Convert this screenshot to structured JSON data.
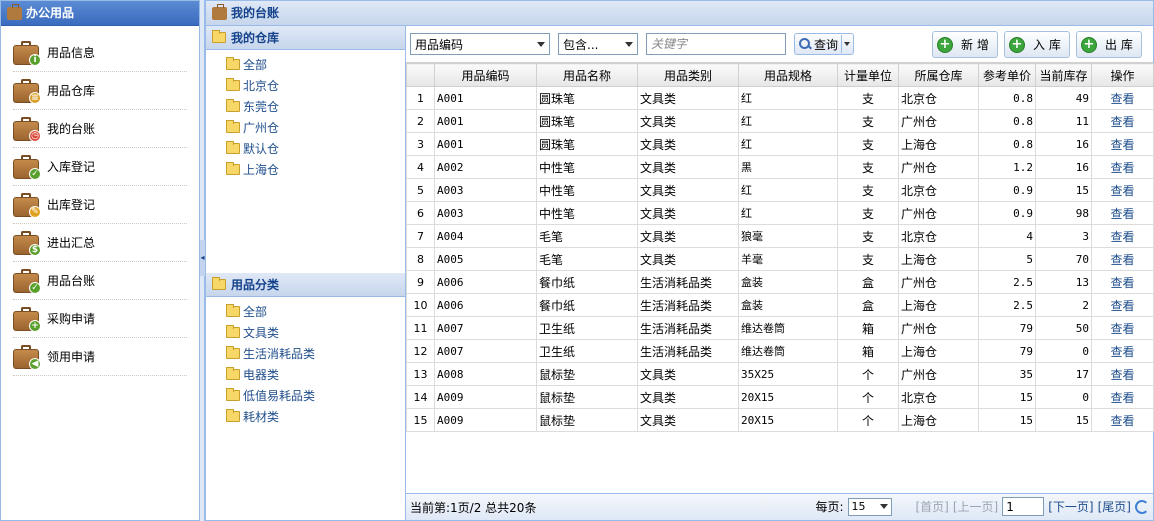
{
  "sidebar": {
    "title": "办公用品",
    "items": [
      {
        "label": "用品信息",
        "badge": "i",
        "badge_color": "#5aa02c"
      },
      {
        "label": "用品仓库",
        "badge": "≡",
        "badge_color": "#d9a02a"
      },
      {
        "label": "我的台账",
        "badge": "◷",
        "badge_color": "#d94a3a"
      },
      {
        "label": "入库登记",
        "badge": "✓",
        "badge_color": "#5aa02c"
      },
      {
        "label": "出库登记",
        "badge": "✎",
        "badge_color": "#e0a020"
      },
      {
        "label": "进出汇总",
        "badge": "$",
        "badge_color": "#5aa02c"
      },
      {
        "label": "用品台账",
        "badge": "✓",
        "badge_color": "#5aa02c"
      },
      {
        "label": "采购申请",
        "badge": "+",
        "badge_color": "#5aa02c"
      },
      {
        "label": "领用申请",
        "badge": "◀",
        "badge_color": "#5aa02c"
      }
    ]
  },
  "main": {
    "title": "我的台账"
  },
  "warehouses": {
    "title": "我的仓库",
    "items": [
      "全部",
      "北京仓",
      "东莞仓",
      "广州仓",
      "默认仓",
      "上海仓"
    ]
  },
  "categories": {
    "title": "用品分类",
    "items": [
      "全部",
      "文具类",
      "生活消耗品类",
      "电器类",
      "低值易耗品类",
      "耗材类"
    ]
  },
  "toolbar": {
    "field_select": "用品编码",
    "match_select": "包含...",
    "keyword_placeholder": "关键字",
    "query_label": "查询",
    "add_label": "新 增",
    "in_label": "入 库",
    "out_label": "出 库"
  },
  "table": {
    "columns": [
      "",
      "用品编码",
      "用品名称",
      "用品类别",
      "用品规格",
      "计量单位",
      "所属仓库",
      "参考单价",
      "当前库存",
      "操作"
    ],
    "rows": [
      [
        "1",
        "A001",
        "圆珠笔",
        "文具类",
        "红",
        "支",
        "北京仓",
        "0.8",
        "49",
        "查看"
      ],
      [
        "2",
        "A001",
        "圆珠笔",
        "文具类",
        "红",
        "支",
        "广州仓",
        "0.8",
        "11",
        "查看"
      ],
      [
        "3",
        "A001",
        "圆珠笔",
        "文具类",
        "红",
        "支",
        "上海仓",
        "0.8",
        "16",
        "查看"
      ],
      [
        "4",
        "A002",
        "中性笔",
        "文具类",
        "黑",
        "支",
        "广州仓",
        "1.2",
        "16",
        "查看"
      ],
      [
        "5",
        "A003",
        "中性笔",
        "文具类",
        "红",
        "支",
        "北京仓",
        "0.9",
        "15",
        "查看"
      ],
      [
        "6",
        "A003",
        "中性笔",
        "文具类",
        "红",
        "支",
        "广州仓",
        "0.9",
        "98",
        "查看"
      ],
      [
        "7",
        "A004",
        "毛笔",
        "文具类",
        "狼毫",
        "支",
        "北京仓",
        "4",
        "3",
        "查看"
      ],
      [
        "8",
        "A005",
        "毛笔",
        "文具类",
        "羊毫",
        "支",
        "上海仓",
        "5",
        "70",
        "查看"
      ],
      [
        "9",
        "A006",
        "餐巾纸",
        "生活消耗品类",
        "盒装",
        "盒",
        "广州仓",
        "2.5",
        "13",
        "查看"
      ],
      [
        "10",
        "A006",
        "餐巾纸",
        "生活消耗品类",
        "盒装",
        "盒",
        "上海仓",
        "2.5",
        "2",
        "查看"
      ],
      [
        "11",
        "A007",
        "卫生纸",
        "生活消耗品类",
        "维达卷筒",
        "箱",
        "广州仓",
        "79",
        "50",
        "查看"
      ],
      [
        "12",
        "A007",
        "卫生纸",
        "生活消耗品类",
        "维达卷筒",
        "箱",
        "上海仓",
        "79",
        "0",
        "查看"
      ],
      [
        "13",
        "A008",
        "鼠标垫",
        "文具类",
        "35X25",
        "个",
        "广州仓",
        "35",
        "17",
        "查看"
      ],
      [
        "14",
        "A009",
        "鼠标垫",
        "文具类",
        "20X15",
        "个",
        "北京仓",
        "15",
        "0",
        "查看"
      ],
      [
        "15",
        "A009",
        "鼠标垫",
        "文具类",
        "20X15",
        "个",
        "上海仓",
        "15",
        "15",
        "查看"
      ]
    ]
  },
  "pager": {
    "summary": "当前第:1页/2 总共20条",
    "page_size_label": "每页:",
    "page_size": "15",
    "first": "[首页]",
    "prev": "[上一页]",
    "current_page": "1",
    "next": "[下一页]",
    "last": "[尾页]"
  }
}
